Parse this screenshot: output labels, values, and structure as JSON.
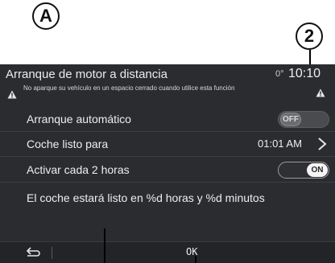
{
  "callouts": {
    "a": "A",
    "b": "2"
  },
  "header": {
    "title": "Arranque de motor a distancia",
    "temperature": "0°",
    "clock": "10:10",
    "warning": "No aparque su vehículo en un espacio cerrado cuando utilice esta función",
    "warning_icon": "warning-triangle-icon"
  },
  "rows": {
    "auto_start": {
      "label": "Arranque automático",
      "toggle": "OFF"
    },
    "ready_for": {
      "label": "Coche listo para",
      "value": "01:01 AM",
      "icon": "chevron-right-icon"
    },
    "every_two_hours": {
      "label": "Activar cada 2 horas",
      "toggle": "ON"
    },
    "message": {
      "label": "El coche estará listo en %d horas y %d minutos"
    }
  },
  "footer": {
    "back_icon": "back-arrow-icon",
    "ok_label": "OK"
  },
  "colors": {
    "screen_bg": "#2b2c2f",
    "text": "#eeeeee",
    "footer_bg": "#232427"
  }
}
